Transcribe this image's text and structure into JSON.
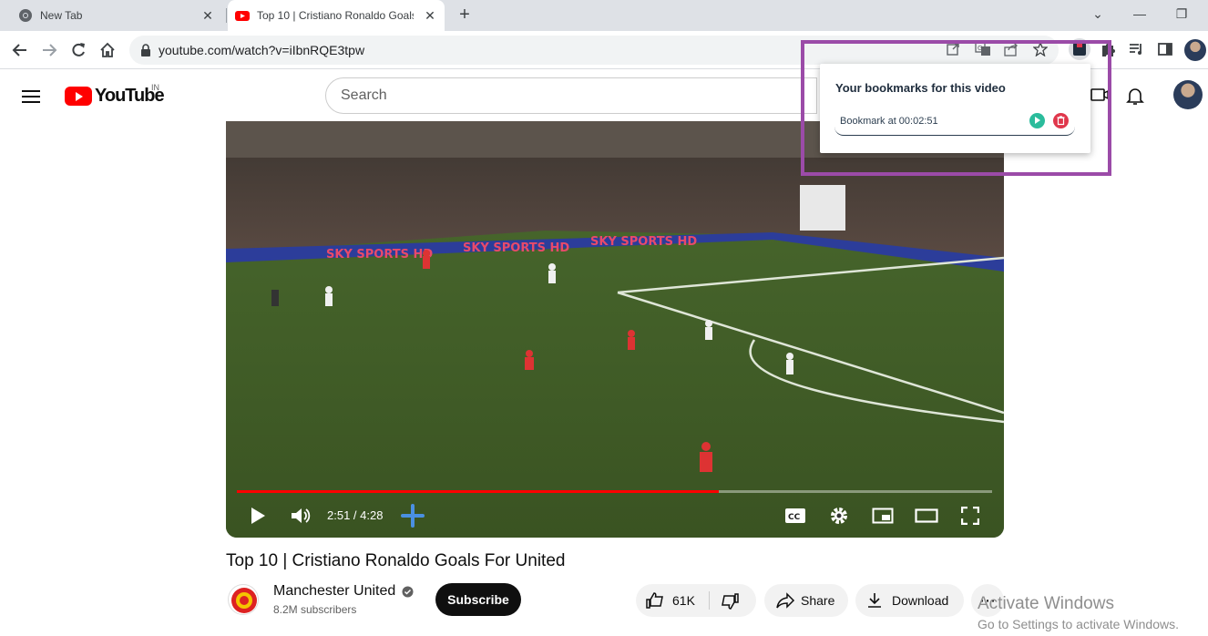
{
  "browser": {
    "tabs": [
      {
        "title": "New Tab",
        "active": false,
        "icon": "chrome-icon"
      },
      {
        "title": "Top 10 | Cristiano Ronaldo Goals",
        "active": true,
        "icon": "youtube-favicon"
      }
    ],
    "url": "youtube.com/watch?v=iIbnRQE3tpw"
  },
  "youtube": {
    "logo_text": "YouTube",
    "country_code": "IN",
    "search_placeholder": "Search"
  },
  "player": {
    "time": "2:51 / 4:28",
    "progress_fraction": 0.638,
    "accent": "#ff0000"
  },
  "video": {
    "title": "Top 10 | Cristiano Ronaldo Goals For United",
    "channel": "Manchester United",
    "subscribers": "8.2M subscribers",
    "subscribe_label": "Subscribe",
    "likes": "61K",
    "share_label": "Share",
    "download_label": "Download"
  },
  "extension_popup": {
    "title": "Your bookmarks for this video",
    "bookmarks": [
      {
        "label": "Bookmark at 00:02:51"
      }
    ],
    "play_color": "#2bbc9c",
    "delete_color": "#e0374c",
    "highlight_color": "#9b4ba8"
  },
  "watermark": {
    "line1": "Activate Windows",
    "line2": "Go to Settings to activate Windows."
  }
}
